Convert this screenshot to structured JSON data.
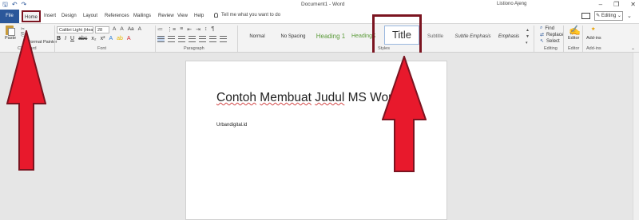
{
  "window": {
    "title": "Document1 - Word",
    "user": "Listiono Ajeng",
    "quick_access": [
      "save-icon",
      "undo-icon",
      "redo-icon"
    ],
    "controls": [
      "minimize-icon",
      "restore-icon",
      "close-icon"
    ]
  },
  "tabs": {
    "items": [
      "File",
      "Home",
      "Insert",
      "Design",
      "Layout",
      "References",
      "Mailings",
      "Review",
      "View",
      "Help"
    ],
    "active": "Home",
    "tell_me": "Tell me what you want to do",
    "editing_mode": "Editing"
  },
  "ribbon": {
    "clipboard": {
      "paste": "Paste",
      "format_painter": "Format Painter",
      "label": "Clipboard"
    },
    "font": {
      "name": "Calibri Light (Hea",
      "size": "28",
      "buttons": [
        "B",
        "I",
        "U",
        "abc",
        "x₂",
        "x²",
        "A",
        "ab",
        "A"
      ],
      "tools": [
        "A",
        "A",
        "Aa",
        "A"
      ],
      "label": "Font"
    },
    "paragraph": {
      "label": "Paragraph",
      "row1": [
        "≔",
        "⋮≡",
        "≡",
        "⇤",
        "⇥",
        "↕",
        "¶"
      ]
    },
    "styles": {
      "items": [
        "Normal",
        "No Spacing",
        "Heading 1",
        "Heading 2",
        "Title",
        "Subtitle",
        "Subtle Emphasis",
        "Emphasis"
      ],
      "label": "Styles",
      "selected": "Title"
    },
    "editing": {
      "find": "Find",
      "replace": "Replace",
      "select": "Select",
      "label": "Editing"
    },
    "editor": {
      "button": "Editor",
      "label": "Editor"
    },
    "addins": {
      "button": "Add-ins",
      "label": "Add-ins"
    }
  },
  "document": {
    "heading": [
      "Contoh",
      " ",
      "Membuat",
      " ",
      "Judul",
      " MS Word"
    ],
    "body": "Urbandigital.id"
  },
  "colors": {
    "accent": "#2b579a",
    "highlight_box": "#7b1420",
    "arrow_fill": "#e8192c",
    "heading_style": "#5b9b3a"
  }
}
